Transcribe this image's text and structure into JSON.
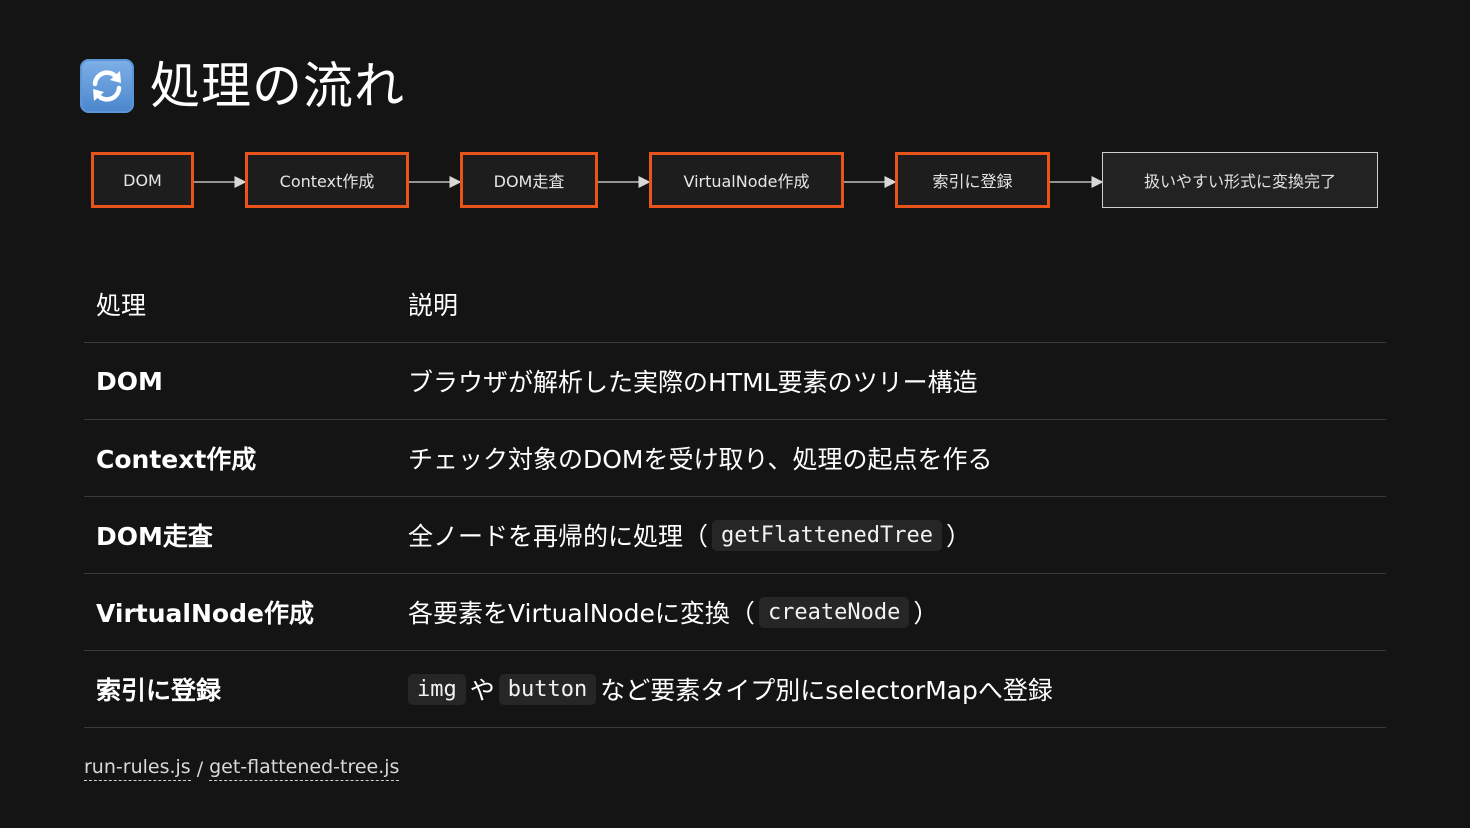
{
  "title": {
    "icon": "counterclockwise-arrows-icon",
    "text": "処理の流れ"
  },
  "flow": {
    "steps": [
      {
        "label": "DOM"
      },
      {
        "label": "Context作成"
      },
      {
        "label": "DOM走査"
      },
      {
        "label": "VirtualNode作成"
      },
      {
        "label": "索引に登録"
      },
      {
        "label": "扱いやすい形式に変換完了"
      }
    ],
    "colors": {
      "step_border": "#e8541a",
      "final_border": "#cfcfcf"
    }
  },
  "table": {
    "headers": {
      "process": "処理",
      "description": "説明"
    },
    "rows": [
      {
        "process": "DOM",
        "desc": "ブラウザが解析した実際のHTML要素のツリー構造"
      },
      {
        "process": "Context作成",
        "desc": "チェック対象のDOMを受け取り、処理の起点を作る"
      },
      {
        "process": "DOM走査",
        "desc_before": "全ノードを再帰的に処理（",
        "code": "getFlattenedTree",
        "desc_after": "）"
      },
      {
        "process": "VirtualNode作成",
        "desc_before": "各要素をVirtualNodeに変換（",
        "code": "createNode",
        "desc_after": "）"
      },
      {
        "process": "索引に登録",
        "code1": "img",
        "mid": "や",
        "code2": "button",
        "desc_after": "など要素タイプ別にselectorMapへ登録"
      }
    ]
  },
  "footer": {
    "link1": "run-rules.js",
    "separator": "/",
    "link2": "get-flattened-tree.js"
  }
}
